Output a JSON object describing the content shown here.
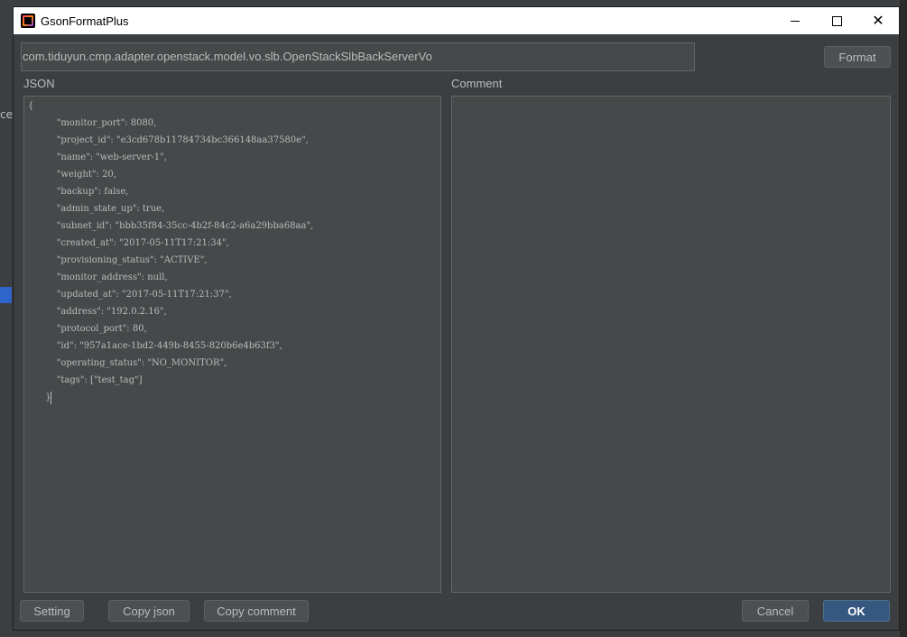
{
  "window": {
    "title": "GsonFormatPlus"
  },
  "background": {
    "left_text": "ce"
  },
  "class_field": {
    "value": "com.tiduyun.cmp.adapter.openstack.model.vo.slb.OpenStackSlbBackServerVo"
  },
  "buttons": {
    "format": "Format",
    "setting": "Setting",
    "copy_json": "Copy  json",
    "copy_comment": "Copy comment",
    "cancel": "Cancel",
    "ok": "OK"
  },
  "labels": {
    "json": "JSON",
    "comment": "Comment"
  },
  "json_text": {
    "open": "{",
    "lines": [
      "          \"monitor_port\": 8080,",
      "          \"project_id\": \"e3cd678b11784734bc366148aa37580e\",",
      "          \"name\": \"web-server-1\",",
      "          \"weight\": 20,",
      "          \"backup\": false,",
      "          \"admin_state_up\": true,",
      "          \"subnet_id\": \"bbb35f84-35cc-4b2f-84c2-a6a29bba68aa\",",
      "          \"created_at\": \"2017-05-11T17:21:34\",",
      "          \"provisioning_status\": \"ACTIVE\",",
      "          \"monitor_address\": null,",
      "          \"updated_at\": \"2017-05-11T17:21:37\",",
      "          \"address\": \"192.0.2.16\",",
      "          \"protocol_port\": 80,",
      "          \"id\": \"957a1ace-1bd2-449b-8455-820b6e4b63f3\",",
      "          \"operating_status\": \"NO_MONITOR\",",
      "          \"tags\": [\"test_tag\"]"
    ],
    "close": "      }"
  },
  "comment_text": ""
}
